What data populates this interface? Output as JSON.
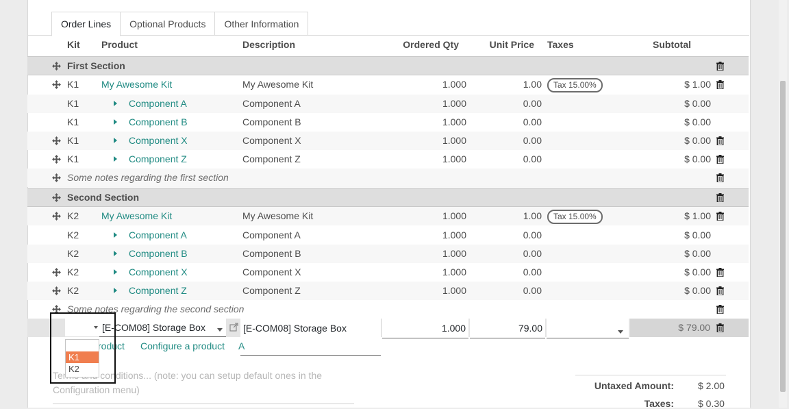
{
  "tabs": [
    "Order Lines",
    "Optional Products",
    "Other Information"
  ],
  "columns": {
    "kit": "Kit",
    "product": "Product",
    "description": "Description",
    "qty": "Ordered Qty",
    "price": "Unit Price",
    "taxes": "Taxes",
    "subtotal": "Subtotal"
  },
  "rows": [
    {
      "type": "section",
      "title": "First Section"
    },
    {
      "type": "line",
      "kit": "K1",
      "product": "My Awesome Kit",
      "description": "My Awesome Kit",
      "qty": "1.000",
      "price": "1.00",
      "tax": "Tax 15.00%",
      "subtotal": "$ 1.00",
      "handle": true,
      "trash": true,
      "component": false
    },
    {
      "type": "line",
      "kit": "K1",
      "product": "Component A",
      "description": "Component A",
      "qty": "1.000",
      "price": "0.00",
      "tax": "",
      "subtotal": "$ 0.00",
      "handle": false,
      "trash": false,
      "component": true
    },
    {
      "type": "line",
      "kit": "K1",
      "product": "Component B",
      "description": "Component B",
      "qty": "1.000",
      "price": "0.00",
      "tax": "",
      "subtotal": "$ 0.00",
      "handle": false,
      "trash": false,
      "component": true
    },
    {
      "type": "line",
      "kit": "K1",
      "product": "Component X",
      "description": "Component X",
      "qty": "1.000",
      "price": "0.00",
      "tax": "",
      "subtotal": "$ 0.00",
      "handle": true,
      "trash": true,
      "component": true
    },
    {
      "type": "line",
      "kit": "K1",
      "product": "Component Z",
      "description": "Component Z",
      "qty": "1.000",
      "price": "0.00",
      "tax": "",
      "subtotal": "$ 0.00",
      "handle": true,
      "trash": true,
      "component": true
    },
    {
      "type": "note",
      "text": "Some notes regarding the first section"
    },
    {
      "type": "section",
      "title": "Second Section"
    },
    {
      "type": "line",
      "kit": "K2",
      "product": "My Awesome Kit",
      "description": "My Awesome Kit",
      "qty": "1.000",
      "price": "1.00",
      "tax": "Tax 15.00%",
      "subtotal": "$ 1.00",
      "handle": true,
      "trash": true,
      "component": false
    },
    {
      "type": "line",
      "kit": "K2",
      "product": "Component A",
      "description": "Component A",
      "qty": "1.000",
      "price": "0.00",
      "tax": "",
      "subtotal": "$ 0.00",
      "handle": false,
      "trash": false,
      "component": true
    },
    {
      "type": "line",
      "kit": "K2",
      "product": "Component B",
      "description": "Component B",
      "qty": "1.000",
      "price": "0.00",
      "tax": "",
      "subtotal": "$ 0.00",
      "handle": false,
      "trash": false,
      "component": true
    },
    {
      "type": "line",
      "kit": "K2",
      "product": "Component X",
      "description": "Component X",
      "qty": "1.000",
      "price": "0.00",
      "tax": "",
      "subtotal": "$ 0.00",
      "handle": true,
      "trash": true,
      "component": true
    },
    {
      "type": "line",
      "kit": "K2",
      "product": "Component Z",
      "description": "Component Z",
      "qty": "1.000",
      "price": "0.00",
      "tax": "",
      "subtotal": "$ 0.00",
      "handle": true,
      "trash": true,
      "component": true
    },
    {
      "type": "note",
      "text": "Some notes regarding the second section"
    }
  ],
  "edit_row": {
    "product": "[E-COM08] Storage Box",
    "description": "[E-COM08] Storage Box",
    "qty": "1.000",
    "price": "79.00",
    "subtotal": "$ 79.00"
  },
  "kit_dropdown": [
    "",
    "K1",
    "K2"
  ],
  "kit_selected": "K1",
  "add_links": {
    "product": "roduct",
    "configure": "Configure a product",
    "note": "A"
  },
  "terms_placeholder": "Terms and conditions... (note: you can setup default ones in the Configuration menu)",
  "totals": {
    "untaxed_label": "Untaxed Amount:",
    "untaxed_value": "$ 2.00",
    "taxes_label": "Taxes:",
    "taxes_value": "$ 0.30"
  },
  "colors": {
    "link": "#1f8a82",
    "highlight": "#f07e4f",
    "section_bg": "#dedede"
  }
}
